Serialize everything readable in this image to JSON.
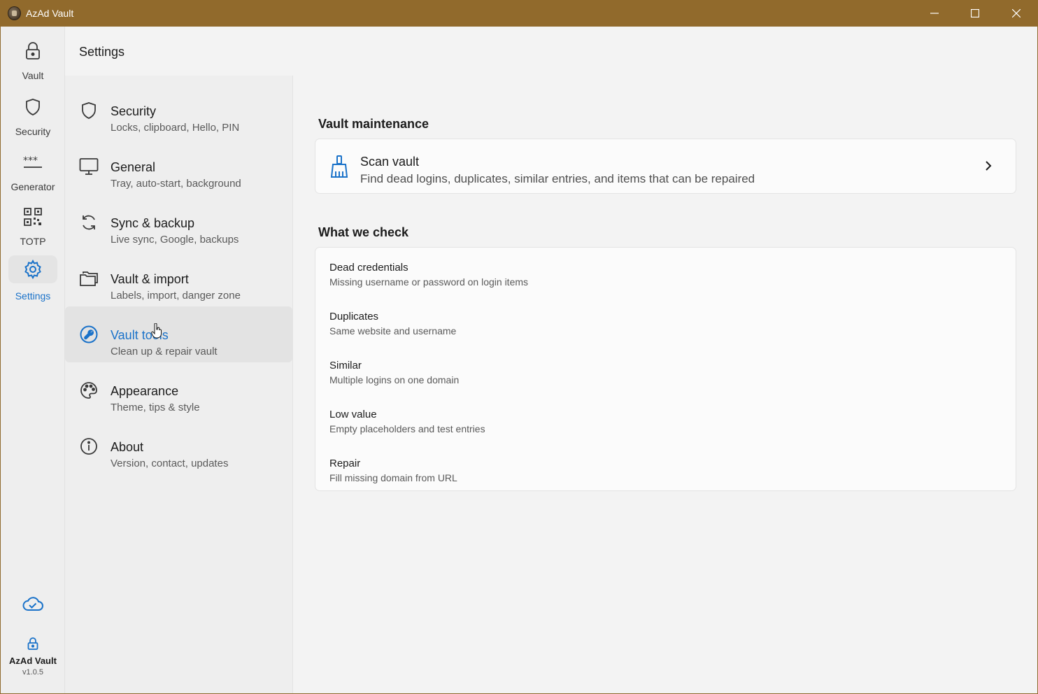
{
  "window": {
    "title": "AzAd Vault"
  },
  "rail": {
    "items": [
      {
        "label": "Vault",
        "icon": "lock-icon"
      },
      {
        "label": "Security",
        "icon": "shield-icon"
      },
      {
        "label": "Generator",
        "icon": "password-dots-icon"
      },
      {
        "label": "TOTP",
        "icon": "qr-code-icon"
      },
      {
        "label": "Settings",
        "icon": "gear-icon",
        "active": true
      }
    ],
    "footer": {
      "app_name": "AzAd Vault",
      "version": "v1.0.5",
      "sync_icon": "cloud-check-icon"
    }
  },
  "page": {
    "title": "Settings"
  },
  "settings_list": [
    {
      "title": "Security",
      "desc": "Locks, clipboard, Hello, PIN",
      "icon": "shield-icon"
    },
    {
      "title": "General",
      "desc": "Tray, auto-start, background",
      "icon": "monitor-icon"
    },
    {
      "title": "Sync & backup",
      "desc": "Live sync, Google, backups",
      "icon": "sync-icon"
    },
    {
      "title": "Vault & import",
      "desc": "Labels, import, danger zone",
      "icon": "folders-icon"
    },
    {
      "title": "Vault tools",
      "desc": "Clean up & repair vault",
      "icon": "wrench-icon",
      "active": true
    },
    {
      "title": "Appearance",
      "desc": "Theme, tips & style",
      "icon": "palette-icon"
    },
    {
      "title": "About",
      "desc": "Version, contact, updates",
      "icon": "info-icon"
    }
  ],
  "content": {
    "maintenance_title": "Vault maintenance",
    "scan": {
      "title": "Scan vault",
      "desc": "Find dead logins, duplicates, similar entries, and items that can be repaired",
      "icon": "broom-icon"
    },
    "checks_title": "What we check",
    "checks": [
      {
        "title": "Dead credentials",
        "desc": "Missing username or password on login items"
      },
      {
        "title": "Duplicates",
        "desc": "Same website and username"
      },
      {
        "title": "Similar",
        "desc": "Multiple logins on one domain"
      },
      {
        "title": "Low value",
        "desc": "Empty placeholders and test entries"
      },
      {
        "title": "Repair",
        "desc": "Fill missing domain from URL"
      }
    ]
  },
  "colors": {
    "accent": "#1a72c9",
    "titlebar": "#916a2c"
  }
}
